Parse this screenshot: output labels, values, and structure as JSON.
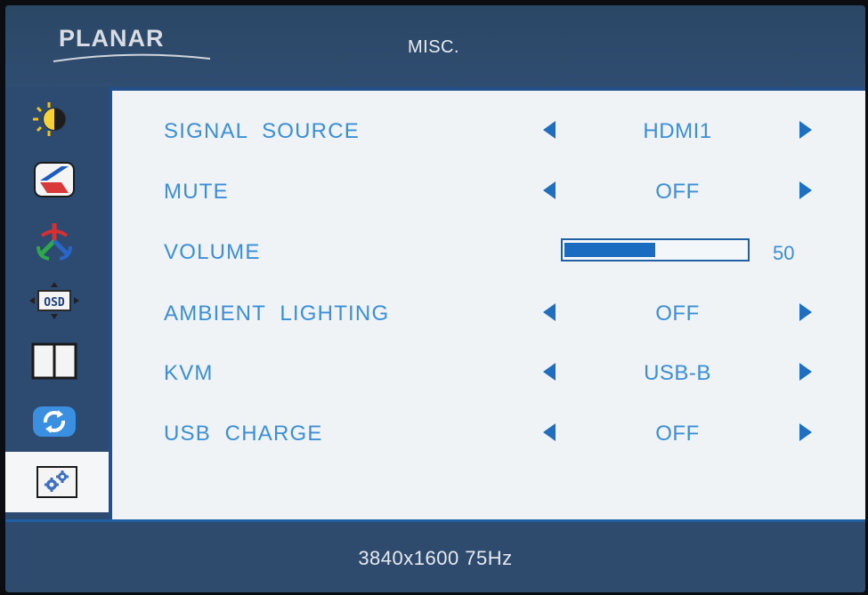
{
  "header": {
    "logo": "PLANAR",
    "title": "MISC."
  },
  "sidebar": {
    "items": [
      {
        "icon": "brightness-contrast-icon"
      },
      {
        "icon": "input-source-icon"
      },
      {
        "icon": "color-icon"
      },
      {
        "icon": "osd-position-icon"
      },
      {
        "icon": "pip-layout-icon"
      },
      {
        "icon": "reset-icon"
      },
      {
        "icon": "misc-settings-icon"
      }
    ],
    "active_index": 6
  },
  "menu": {
    "rows": [
      {
        "label": "SIGNAL  SOURCE",
        "value": "HDMI1"
      },
      {
        "label": "MUTE",
        "value": "OFF"
      },
      {
        "label": "VOLUME",
        "value": "50",
        "level": 50
      },
      {
        "label": "AMBIENT  LIGHTING",
        "value": "OFF"
      },
      {
        "label": "KVM",
        "value": "USB-B"
      },
      {
        "label": "USB  CHARGE",
        "value": "OFF"
      }
    ]
  },
  "footer": {
    "status": "3840x1600  75Hz"
  },
  "colors": {
    "frame": "#2e4a6c",
    "panel": "#f0f3f5",
    "text_accent": "#3a8fd6",
    "arrow": "#1e6fc0"
  }
}
